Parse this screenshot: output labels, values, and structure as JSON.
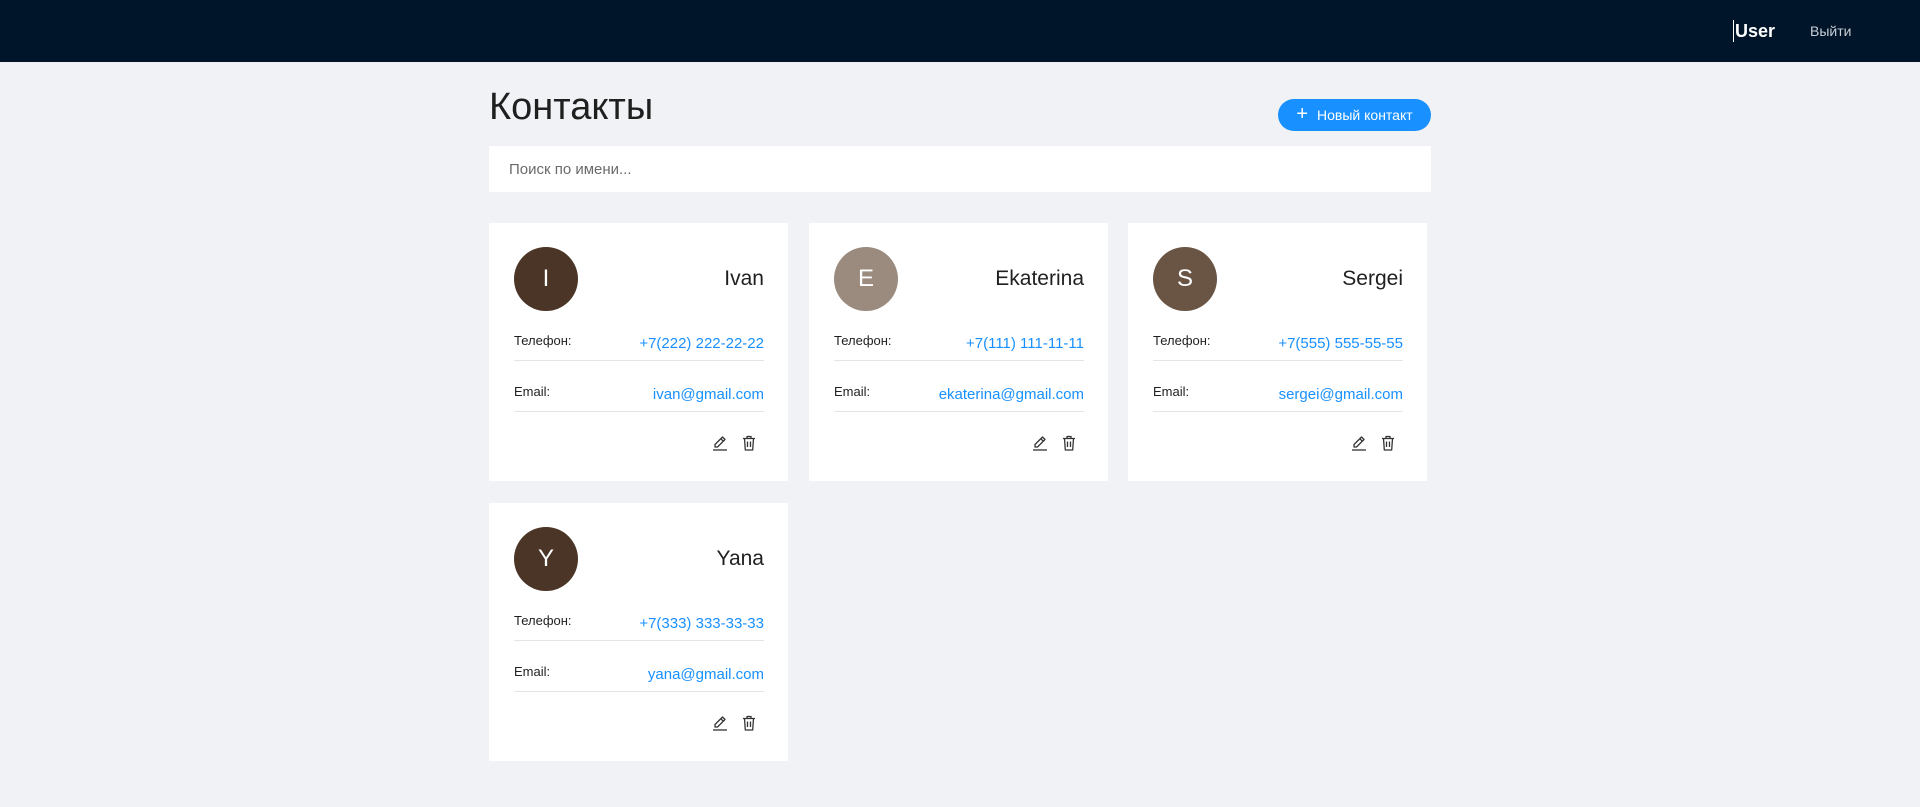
{
  "header": {
    "user_name": "User",
    "logout_label": "Выйти"
  },
  "page": {
    "title": "Контакты",
    "new_contact_label": "Новый контакт",
    "search_placeholder": "Поиск по имени..."
  },
  "labels": {
    "phone": "Телефон:",
    "email": "Email:"
  },
  "contacts": [
    {
      "initial": "I",
      "name": "Ivan",
      "phone": "+7(222) 222-22-22",
      "email": "ivan@gmail.com",
      "avatar_color": "#4a3526"
    },
    {
      "initial": "E",
      "name": "Ekaterina",
      "phone": "+7(111) 111-11-11",
      "email": "ekaterina@gmail.com",
      "avatar_color": "#9a8b7e"
    },
    {
      "initial": "S",
      "name": "Sergei",
      "phone": "+7(555) 555-55-55",
      "email": "sergei@gmail.com",
      "avatar_color": "#6a5545"
    },
    {
      "initial": "Y",
      "name": "Yana",
      "phone": "+7(333) 333-33-33",
      "email": "yana@gmail.com",
      "avatar_color": "#4a3526"
    }
  ],
  "colors": {
    "topbar": "#001529",
    "accent": "#1890ff",
    "background": "#f0f2f5"
  },
  "icons": {
    "new_contact": "plus-icon",
    "edit": "pencil-icon",
    "delete": "trash-icon"
  }
}
